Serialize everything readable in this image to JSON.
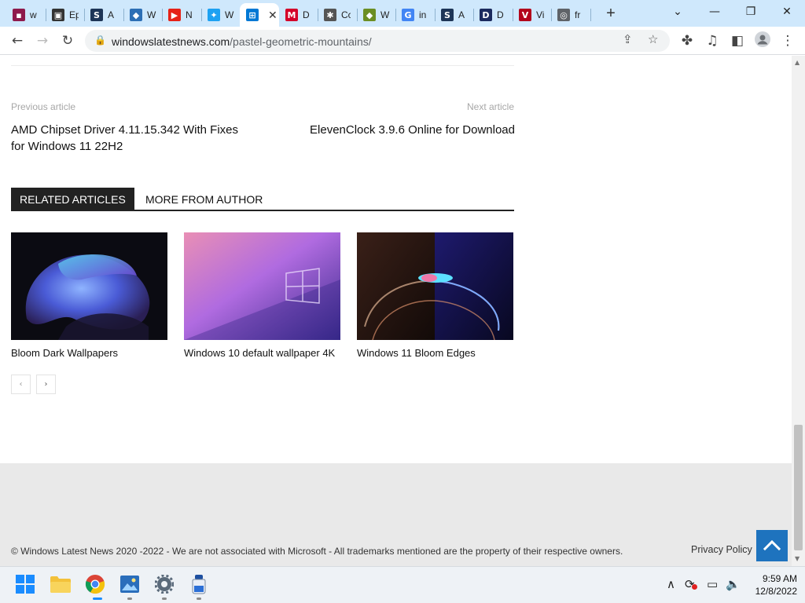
{
  "browser": {
    "tabs": [
      {
        "title": "w",
        "icon": "maroon-square-icon",
        "color": "#8e1a4c",
        "glyph": "▪"
      },
      {
        "title": "Ep",
        "icon": "monitor-icon",
        "color": "#333333",
        "glyph": "▣"
      },
      {
        "title": "A",
        "icon": "s-logo-icon",
        "color": "#1d3557",
        "glyph": "S"
      },
      {
        "title": "W",
        "icon": "paint-icon",
        "color": "#2d6fb5",
        "glyph": "◆"
      },
      {
        "title": "N",
        "icon": "youtube-icon",
        "color": "#e62117",
        "glyph": "▶"
      },
      {
        "title": "W",
        "icon": "twitter-icon",
        "color": "#1da1f2",
        "glyph": "✦"
      },
      {
        "title": "",
        "icon": "windows-icon",
        "color": "#0078d4",
        "glyph": "⊞",
        "active": true
      },
      {
        "title": "D",
        "icon": "mcafee-icon",
        "color": "#d4002a",
        "glyph": "M"
      },
      {
        "title": "Cc",
        "icon": "bug-icon",
        "color": "#555555",
        "glyph": "✱"
      },
      {
        "title": "W",
        "icon": "paint-icon",
        "color": "#6b8e23",
        "glyph": "◆"
      },
      {
        "title": "in",
        "icon": "google-icon",
        "color": "#4285f4",
        "glyph": "G"
      },
      {
        "title": "A",
        "icon": "s-logo-icon",
        "color": "#1d3557",
        "glyph": "S"
      },
      {
        "title": "D",
        "icon": "d-logo-icon",
        "color": "#1b2a5e",
        "glyph": "D"
      },
      {
        "title": "Vi",
        "icon": "vs-icon",
        "color": "#b3001b",
        "glyph": "V"
      },
      {
        "title": "fr",
        "icon": "globe-icon",
        "color": "#5f6368",
        "glyph": "◎"
      }
    ],
    "active_close": "✕",
    "new_tab": "+",
    "url_host": "windowslatestnews.com",
    "url_path": "/pastel-geometric-mountains/"
  },
  "article_nav": {
    "prev_label": "Previous article",
    "prev_title": "AMD Chipset Driver 4.11.15.342 With Fixes for Windows 11 22H2",
    "next_label": "Next article",
    "next_title": "ElevenClock 3.9.6 Online for Download"
  },
  "related": {
    "tab_active": "RELATED ARTICLES",
    "tab_inactive": "MORE FROM AUTHOR",
    "cards": [
      {
        "title": "Bloom Dark Wallpapers"
      },
      {
        "title": "Windows 10 default wallpaper 4K"
      },
      {
        "title": "Windows 11 Bloom Edges"
      }
    ],
    "prev_arrow": "‹",
    "next_arrow": "›"
  },
  "footer": {
    "copyright": "© Windows Latest News 2020 -2022 - We are not associated with Microsoft - All trademarks mentioned are the property of their respective owners.",
    "privacy": "Privacy Policy"
  },
  "taskbar": {
    "time": "9:59 AM",
    "date": "12/8/2022"
  },
  "colors": {
    "accent_blue": "#1e73be",
    "tab_strip": "#cfe8fc"
  }
}
